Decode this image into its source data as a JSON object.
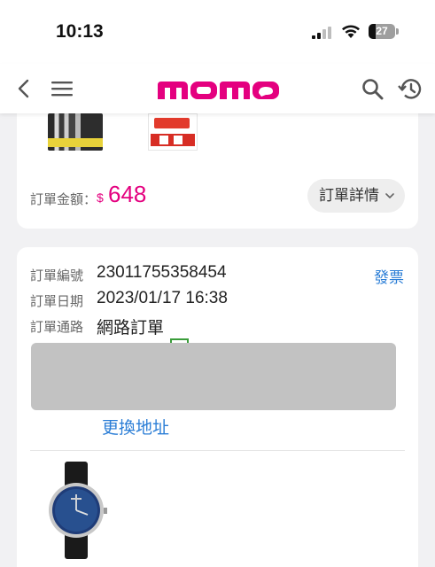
{
  "status_bar": {
    "time": "10:13",
    "battery": 27
  },
  "nav": {
    "back_icon": "chevron-left-icon",
    "menu_icon": "hamburger-menu-icon",
    "logo_text": "momo",
    "search_icon": "search-icon",
    "history_icon": "history-clock-icon",
    "brand_color": "#e4007f"
  },
  "order1": {
    "amount_label": "訂單金額：",
    "currency": "$",
    "amount": "648",
    "detail_button": "訂單詳情"
  },
  "order2": {
    "order_no_label": "訂單編號",
    "order_no": "23011755358454",
    "invoice_link": "發票",
    "order_date_label": "訂單日期",
    "order_date": "2023/01/17 16:38",
    "channel_label": "訂單通路",
    "channel": "網路訂單",
    "change_address": "更換地址"
  }
}
